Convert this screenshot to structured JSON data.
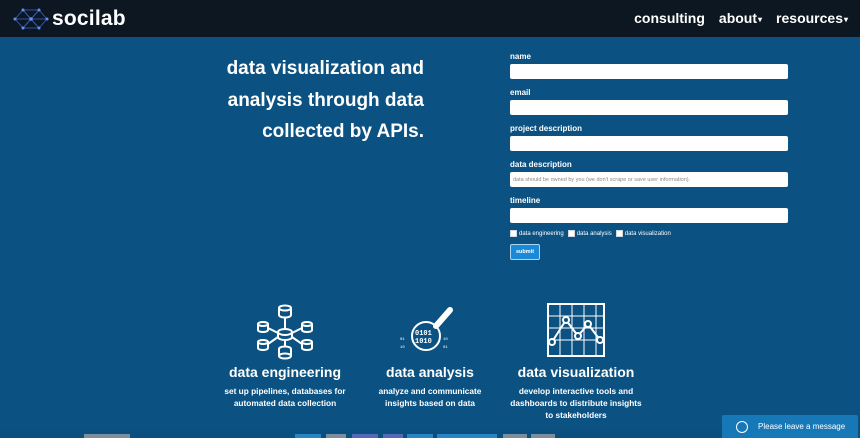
{
  "nav": {
    "brand": "socilab",
    "logo_icon": "network-logo-icon",
    "menu": [
      {
        "label": "consulting",
        "has_dropdown": false
      },
      {
        "label": "about",
        "has_dropdown": true
      },
      {
        "label": "resources",
        "has_dropdown": true
      }
    ]
  },
  "hero": {
    "line1": "data visualization and",
    "line2": "analysis through data",
    "line3": "collected by APIs."
  },
  "form": {
    "name_label": "name",
    "email_label": "email",
    "project_label": "project description",
    "data_label": "data description",
    "data_placeholder": "data should be owned by you (we don't scrape or save user information).",
    "timeline_label": "timeline",
    "checkboxes": [
      "data engineering",
      "data analysis",
      "data visualization"
    ],
    "submit": "submit"
  },
  "services": [
    {
      "icon": "database-network-icon",
      "title": "data engineering",
      "desc1": "set up pipelines, databases for",
      "desc2": "automated data collection",
      "desc3": ""
    },
    {
      "icon": "magnifier-binary-icon",
      "title": "data analysis",
      "desc1": "analyze and communicate",
      "desc2": "insights based on data",
      "desc3": ""
    },
    {
      "icon": "line-chart-icon",
      "title": "data visualization",
      "desc1": "develop interactive tools and",
      "desc2": "dashboards to distribute insights",
      "desc3": "to stakeholders"
    }
  ],
  "chat": {
    "label": "Please leave a message",
    "icon": "chat-clock-icon"
  },
  "colors": {
    "background": "#0b5282",
    "navbar": "#0c1722",
    "button": "#1a8ad8",
    "chat": "#1778b8"
  }
}
